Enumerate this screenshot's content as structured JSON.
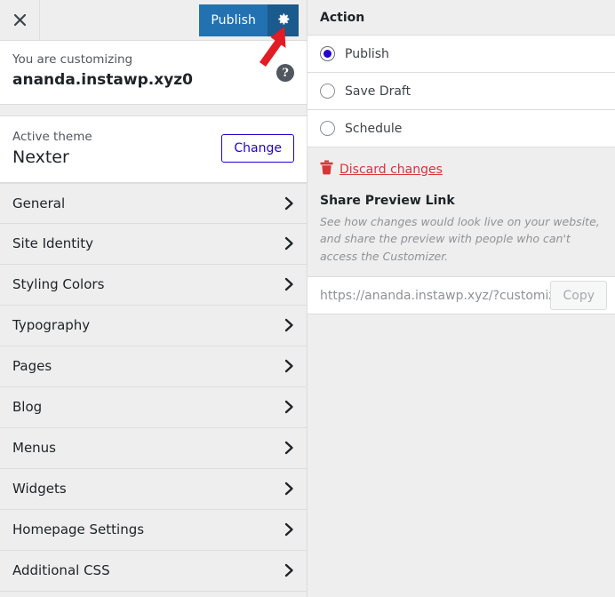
{
  "customizer": {
    "topbar": {
      "close_icon": "close-x-icon",
      "publish_label": "Publish",
      "gear_icon": "gear-icon"
    },
    "info": {
      "eyebrow": "You are customizing",
      "site_title": "ananda.instawp.xyz0",
      "help_glyph": "?",
      "help_icon": "help-circle-icon"
    },
    "theme": {
      "label": "Active theme",
      "name": "Nexter",
      "change_label": "Change"
    },
    "sections": [
      {
        "label": "General",
        "chevron_icon": "chevron-right-icon"
      },
      {
        "label": "Site Identity",
        "chevron_icon": "chevron-right-icon"
      },
      {
        "label": "Styling Colors",
        "chevron_icon": "chevron-right-icon"
      },
      {
        "label": "Typography",
        "chevron_icon": "chevron-right-icon"
      },
      {
        "label": "Pages",
        "chevron_icon": "chevron-right-icon"
      },
      {
        "label": "Blog",
        "chevron_icon": "chevron-right-icon"
      },
      {
        "label": "Menus",
        "chevron_icon": "chevron-right-icon"
      },
      {
        "label": "Widgets",
        "chevron_icon": "chevron-right-icon"
      },
      {
        "label": "Homepage Settings",
        "chevron_icon": "chevron-right-icon"
      },
      {
        "label": "Additional CSS",
        "chevron_icon": "chevron-right-icon"
      }
    ]
  },
  "publish_settings": {
    "header": "Action",
    "actions": [
      {
        "label": "Publish",
        "selected": true
      },
      {
        "label": "Save Draft",
        "selected": false
      },
      {
        "label": "Schedule",
        "selected": false
      }
    ],
    "discard": {
      "label": "Discard changes",
      "icon": "trash-icon"
    },
    "share": {
      "title": "Share Preview Link",
      "description": "See how changes would look live on your website, and share the preview with people who can't access the Customizer.",
      "url_value": "https://ananda.instawp.xyz/?customize_changeset_uuid=",
      "url_placeholder": "https://ananda.instawp.xyz/?customize_chan",
      "copy_label": "Copy"
    }
  },
  "annotation": {
    "arrow_icon": "red-arrow-pointing-to-gear",
    "color": "#e31b23"
  },
  "colors": {
    "publish_blue": "#2271b1",
    "gear_blue": "#1b5a8c",
    "panel_grey": "#eeeeee",
    "white": "#ffffff",
    "border": "#dddddd",
    "link_red": "#d63638",
    "radio_blue": "#2400d1",
    "annotation_red": "#e31b23"
  }
}
